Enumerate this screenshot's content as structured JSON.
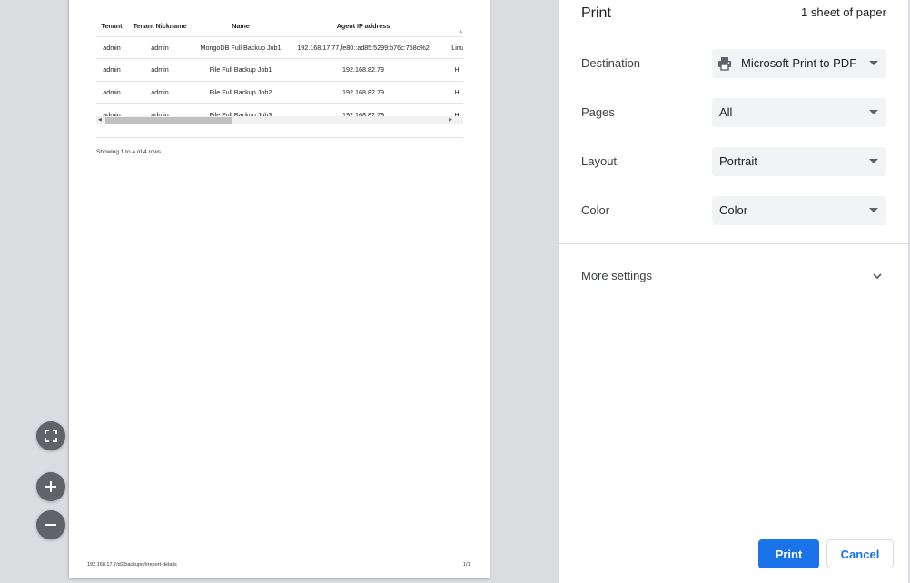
{
  "preview": {
    "columns": [
      "Tenant",
      "Tenant Nickname",
      "Name",
      "Agent IP address",
      ""
    ],
    "rows": [
      [
        "admin",
        "admin",
        "MongoDB Full Backup Job1",
        "192.168.17.77,fe80::ad85:5299:b76c:758c%2",
        "Linu"
      ],
      [
        "admin",
        "admin",
        "File Full Backup Job1",
        "192.168.82.79",
        "HI"
      ],
      [
        "admin",
        "admin",
        "File Full Backup Job2",
        "192.168.82.79",
        "HI"
      ],
      [
        "admin",
        "admin",
        "File Full Backup Job3",
        "192.168.82.79",
        "HI"
      ]
    ],
    "showing_text": "Showing 1 to 4 of 4 rows",
    "footer_url": "192.168.17.7/d2/backupd/#report-details",
    "footer_page": "1/1"
  },
  "zoom": {
    "fit_icon": "fit-to-page-icon",
    "zoom_in_icon": "plus-icon",
    "zoom_out_icon": "minus-icon"
  },
  "panel": {
    "title": "Print",
    "sheet_count": "1 sheet of paper",
    "destination": {
      "label": "Destination",
      "value": "Microsoft Print to PDF",
      "icon": "printer-icon"
    },
    "pages": {
      "label": "Pages",
      "value": "All"
    },
    "layout": {
      "label": "Layout",
      "value": "Portrait"
    },
    "color": {
      "label": "Color",
      "value": "Color"
    },
    "more_settings": "More settings",
    "print_button": "Print",
    "cancel_button": "Cancel",
    "accent": "#1a73e8"
  }
}
